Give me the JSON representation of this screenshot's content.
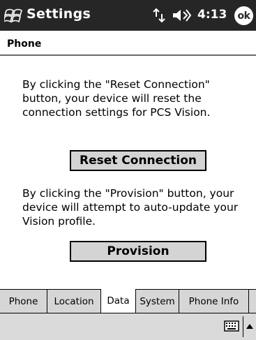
{
  "titlebar": {
    "title": "Settings",
    "clock": "4:13",
    "ok_label": "ok",
    "icons": [
      "windows-start-icon",
      "connectivity-icon",
      "volume-icon"
    ]
  },
  "page": {
    "header": "Phone",
    "reset_text": "By clicking the \"Reset Connection\" button, your device will reset the connection settings for PCS Vision.",
    "reset_button": "Reset Connection",
    "provision_text": "By clicking the \"Provision\" button, your device will attempt to auto-update your Vision profile.",
    "provision_button": "Provision"
  },
  "tabs": [
    {
      "label": "Phone",
      "active": false
    },
    {
      "label": "Location",
      "active": false
    },
    {
      "label": "Data",
      "active": true
    },
    {
      "label": "System",
      "active": false
    },
    {
      "label": "Phone Info",
      "active": false
    }
  ],
  "menubar": {
    "icons": [
      "keyboard-icon",
      "input-menu-arrow-icon"
    ]
  },
  "colors": {
    "titlebar_bg": "#262626",
    "button_bg": "#d4d4d4",
    "tab_bg": "#d6d6d6",
    "menubar_bg": "#dadada"
  }
}
